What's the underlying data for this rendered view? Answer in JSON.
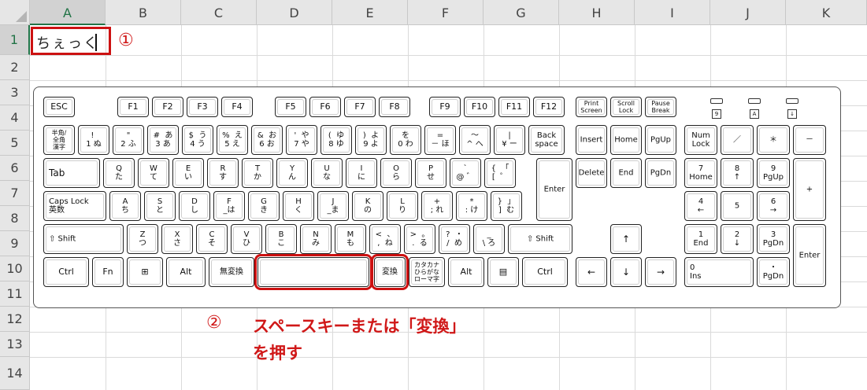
{
  "spreadsheet": {
    "columns": [
      "A",
      "B",
      "C",
      "D",
      "E",
      "F",
      "G",
      "H",
      "I",
      "J",
      "K"
    ],
    "rows": [
      "1",
      "2",
      "3",
      "4",
      "5",
      "6",
      "7",
      "8",
      "9",
      "10",
      "11",
      "12",
      "13",
      "14"
    ],
    "selected_column": "A",
    "selected_row": "1",
    "cell_a1_text": "ちぇっく"
  },
  "callouts": {
    "step1_marker": "①",
    "step2_marker": "②",
    "step2_line1": "スペースキーまたは「変換」",
    "step2_line2": "を押す",
    "highlight_color": "#cc1111"
  },
  "keyboard": {
    "function_row": [
      "ESC",
      "F1",
      "F2",
      "F3",
      "F4",
      "F5",
      "F6",
      "F7",
      "F8",
      "F9",
      "F10",
      "F11",
      "F12",
      "Print\nScreen",
      "Scroll\nLock",
      "Pause\nBreak"
    ],
    "indicators": [
      "9",
      "A",
      "↓"
    ],
    "number_row": [
      "半角/\n全角\n漢字",
      "! \n1 ぬ",
      "\"\n2 ふ",
      "#  あ\n3 あ",
      "$  う\n4 う",
      "%  え\n5 え",
      "&  お\n6 お",
      "'  や\n7 や",
      "(  ゆ\n8 ゆ",
      ")  よ\n9 よ",
      "を\n0 わ",
      "=\n－ ほ",
      "～\n^ へ",
      "|\n¥ ー",
      "Back\nspace"
    ],
    "nav_top": [
      "Insert",
      "Home",
      "PgUp"
    ],
    "numpad_top": [
      "Num\nLock",
      "／",
      "＊",
      "－"
    ],
    "q_row": [
      "Tab",
      "Q\nた",
      "W\nて",
      "E\nい",
      "R\nす",
      "T\nか",
      "Y\nん",
      "U\nな",
      "I\nに",
      "O\nら",
      "P\nせ",
      "`\n@ ゛",
      "{  「\n[  ゜",
      "Enter"
    ],
    "nav_mid": [
      "Delete",
      "End",
      "PgDn"
    ],
    "numpad_row2": [
      "7\nHome",
      "8\n↑",
      "9\nPgUp",
      "+"
    ],
    "a_row": [
      "Caps Lock\n英数",
      "A\nち",
      "S\nと",
      "D\nし",
      "F\n_は",
      "G\nき",
      "H\nく",
      "J\n_ま",
      "K\nの",
      "L\nり",
      "+\n; れ",
      "*\n: け",
      "}  」\n]  む"
    ],
    "numpad_row3": [
      "4\n←",
      "5",
      "6\n→"
    ],
    "z_row": [
      "⇧ Shift",
      "Z\nつ",
      "X\nさ",
      "C\nそ",
      "V\nひ",
      "B\nこ",
      "N\nみ",
      "M\nも",
      "<  、\n,  ね",
      ">  。\n.  る",
      "?  ・\n/  め",
      "_\n\\ ろ",
      "⇧ Shift"
    ],
    "arrow_up": "↑",
    "numpad_row4": [
      "1\nEnd",
      "2\n↓",
      "3\nPgDn",
      "Enter"
    ],
    "bottom_row": [
      "Ctrl",
      "Fn",
      "⊞",
      "Alt",
      "無変換",
      "",
      "変換",
      "カタカナ\nひらがな\nローマ字",
      "Alt",
      "▤",
      "Ctrl"
    ],
    "arrows_bottom": [
      "←",
      "↓",
      "→"
    ],
    "numpad_row5": [
      "0\nIns",
      "・\nPgDn"
    ]
  }
}
